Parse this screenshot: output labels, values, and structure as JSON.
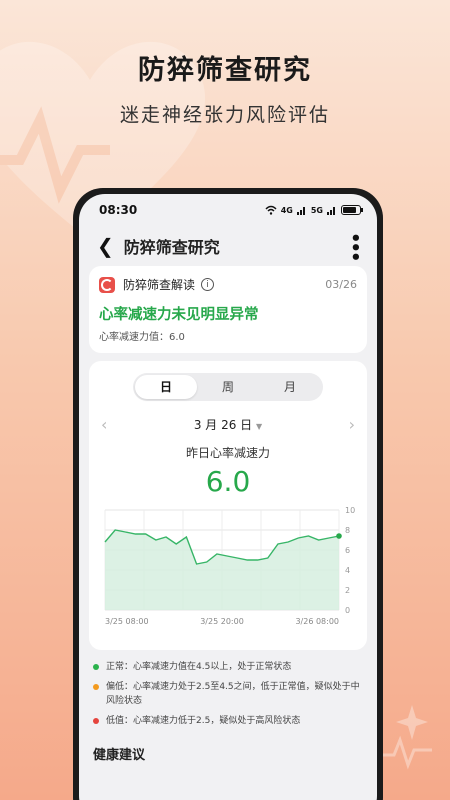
{
  "promo": {
    "title": "防猝筛查研究",
    "subtitle": "迷走神经张力风险评估"
  },
  "status_bar": {
    "time": "08:30",
    "network_1": "4G",
    "network_2": "5G"
  },
  "app_bar": {
    "title": "防猝筛查研究"
  },
  "interpretation": {
    "title": "防猝筛查解读",
    "date": "03/26",
    "status": "心率减速力未见明显异常",
    "value_text": "心率减速力值：6.0"
  },
  "tabs": [
    {
      "label": "日",
      "active": true
    },
    {
      "label": "周",
      "active": false
    },
    {
      "label": "月",
      "active": false
    }
  ],
  "date_nav": {
    "date": "3 月 26 日"
  },
  "metric": {
    "label": "昨日心率减速力",
    "value": "6.0"
  },
  "chart_data": {
    "type": "area",
    "x_ticks": [
      "3/25 08:00",
      "3/25 20:00",
      "3/26 08:00"
    ],
    "y_ticks": [
      "0",
      "2",
      "4",
      "6",
      "8",
      "10"
    ],
    "ylim": [
      0,
      10
    ],
    "values": [
      6.8,
      8.0,
      7.8,
      7.6,
      7.6,
      7.0,
      7.3,
      6.6,
      7.3,
      4.6,
      4.8,
      5.6,
      5.4,
      5.2,
      5.0,
      5.0,
      5.2,
      6.6,
      6.8,
      7.2,
      7.4,
      7.0,
      7.2,
      7.4
    ],
    "grid": true,
    "colors": {
      "line": "#37b567",
      "fill": "#d6efdf",
      "last_point": "#27a84b"
    }
  },
  "legend": [
    {
      "color": "#2bb24c",
      "text": "正常：心率减速力值在4.5以上，处于正常状态"
    },
    {
      "color": "#f39a1e",
      "text": "偏低：心率减速力处于2.5至4.5之间，低于正常值，疑似处于中风险状态"
    },
    {
      "color": "#e5443d",
      "text": "低值：心率减速力低于2.5，疑似处于高风险状态"
    }
  ],
  "advice": {
    "title": "健康建议"
  }
}
